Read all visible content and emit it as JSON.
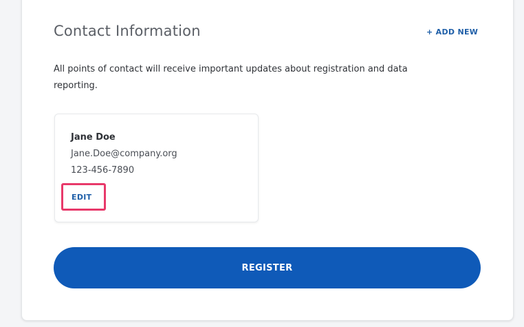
{
  "section": {
    "title": "Contact Information",
    "add_new_label": "+ ADD NEW",
    "description": "All points of contact will receive important updates about registration and data reporting."
  },
  "contacts": [
    {
      "name": "Jane Doe",
      "email": "Jane.Doe@company.org",
      "phone": "123-456-7890",
      "edit_label": "EDIT"
    }
  ],
  "actions": {
    "register_label": "REGISTER"
  },
  "colors": {
    "accent": "#0f5ab8",
    "link": "#1f5fa8",
    "highlight": "#e8396a"
  }
}
